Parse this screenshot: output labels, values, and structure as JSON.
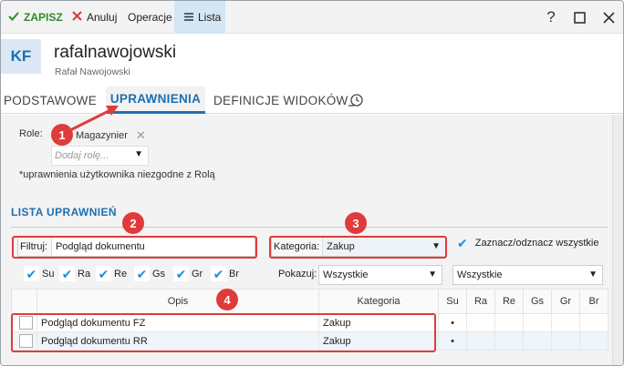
{
  "toolbar": {
    "save": "ZAPISZ",
    "cancel": "Anuluj",
    "operations": "Operacje",
    "list": "Lista",
    "icons": [
      "check-icon",
      "x-icon",
      "list-icon",
      "help-icon",
      "maximize-icon",
      "close-icon"
    ]
  },
  "header": {
    "initials": "KF",
    "login": "rafalnawojowski",
    "full_name": "Rafał Nawojowski"
  },
  "tabs": [
    "PODSTAWOWE",
    "UPRAWNIENIA",
    "DEFINICJE WIDOKÓW"
  ],
  "roles": {
    "label": "Role:",
    "chip": "Magazynier",
    "placeholder": "Dodaj rolę...",
    "note": "*uprawnienia użytkownika niezgodne z Rolą"
  },
  "permissions": {
    "title": "LISTA UPRAWNIEŃ",
    "filter_label": "Filtruj:",
    "filter_value": "Podgląd dokumentu",
    "category_label": "Kategoria:",
    "category_value": "Zakup",
    "select_all": "Zaznacz/odznacz wszystkie",
    "columns_checked": [
      "Su",
      "Ra",
      "Re",
      "Gs",
      "Gr",
      "Br"
    ],
    "show_label": "Pokazuj:",
    "show_value_1": "Wszystkie",
    "show_value_2": "Wszystkie"
  },
  "grid": {
    "headers": {
      "desc": "Opis",
      "cat": "Kategoria",
      "perms": [
        "Su",
        "Ra",
        "Re",
        "Gs",
        "Gr",
        "Br"
      ]
    },
    "rows": [
      {
        "desc": "Podgląd dokumentu FZ",
        "cat": "Zakup",
        "su": "•"
      },
      {
        "desc": "Podgląd dokumentu RR",
        "cat": "Zakup",
        "su": "•"
      }
    ]
  },
  "annotations": [
    "1",
    "2",
    "3",
    "4"
  ],
  "colors": {
    "accent": "#1e6fb0",
    "save": "#2e8b2e",
    "annotation": "#e03b3b",
    "check": "#1e8fd8"
  }
}
